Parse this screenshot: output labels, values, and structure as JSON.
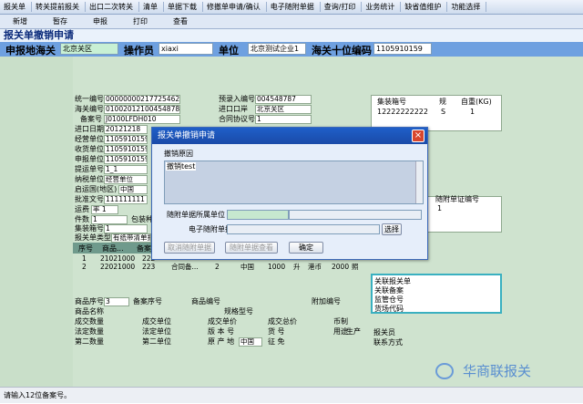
{
  "menu": [
    "报关单",
    "转关提前报关",
    "出口二次转关",
    "清单",
    "单据下载",
    "修撤单申请/确认",
    "电子随附单据",
    "查询/打印",
    "业务统计",
    "缺省值维护",
    "功能选择"
  ],
  "toolbar": [
    "新增",
    "暂存",
    "申报",
    "打印",
    "查看"
  ],
  "page_title": "报关单撤销申请",
  "header": {
    "customs_label": "申报地海关",
    "customs_value": "北京关区",
    "operator_label": "操作员",
    "operator_value": "xiaxi",
    "unit_label": "单位",
    "unit_value": "北京测试企业1",
    "code_label": "海关十位编码",
    "code_value": "1105910159"
  },
  "form": {
    "tongyi_label": "统一编号",
    "tongyi_value": "0000000021772546261",
    "yulu_label": "预录入编号",
    "yulu_value": "004548787",
    "haiguan_label": "海关编号",
    "haiguan_value": "010020121004548787",
    "jinchu_label": "进口口岸",
    "jinchu_value": "北京关区",
    "beian_label": "备案号",
    "beian_value": "J0100LFDH010",
    "hetong_label": "合同协议号",
    "hetong_value": "1",
    "jkrq_label": "进口日期",
    "jkrq_value": "20121218",
    "jydw_label": "经营单位",
    "jydw_value": "1105910159",
    "shdw_label": "收货单位",
    "shdw_value": "1105910159",
    "sbdw_label": "申报单位",
    "sbdw_value": "1105910159",
    "tydh_label": "提运单号",
    "tydh_value": "1_1",
    "nsdw_label": "纳税单位",
    "nsdw_value": "经营单位",
    "qydg_label": "启运国(地区)",
    "qydg_value": "中国",
    "pzwh_label": "批准文号",
    "pzwh_value": "111111111",
    "yunfei_label": "运费",
    "yunfei_value": "率 1",
    "jianshu_label": "件数",
    "jianshu_value": "1",
    "baozhuang_value": "包装种类",
    "jzx_label": "集装箱号",
    "jzx_value": "1",
    "bgdlx_label": "报关单类型",
    "bgdlx_value": "有纸带清单报关"
  },
  "container_grid": {
    "headers": [
      "集装箱号",
      "规",
      "自重(KG)"
    ],
    "rows": [
      [
        "12222222222",
        "S",
        "1"
      ]
    ]
  },
  "doc_grid": {
    "header": "随附单证编号",
    "rows": [
      "1"
    ]
  },
  "goods_grid": {
    "headers": [
      "序号",
      "商品...",
      "备案"
    ],
    "rows": [
      [
        "1",
        "21021000",
        "222",
        "",
        "",
        "",
        "",
        "",
        "",
        "",
        ""
      ],
      [
        "2",
        "22021000",
        "223",
        "合同备...",
        "2",
        "中国",
        "1000",
        "升",
        "港币",
        "2000",
        "照"
      ]
    ]
  },
  "bottom": {
    "spxh_label": "商品序号",
    "spxh_value": "3",
    "baxh_label": "备案序号",
    "spbh_label": "商品编号",
    "fjbh_label": "附加编号",
    "spmc_label": "商品名称",
    "ggxh_label": "规格型号",
    "cjsl_label": "成交数量",
    "cjdw_label": "成交单位",
    "cjdj_label": "成交单价",
    "cjzj_label": "成交总价",
    "bizhi_label": "币制",
    "fdsl_label": "法定数量",
    "fddw_label": "法定单位",
    "banben_label": "版 本 号",
    "huohao_label": "货 号",
    "yongtu_label": "用途",
    "sheng_label": "生产",
    "dier_label": "第二数量",
    "dierdw_label": "第二单位",
    "ycd_label": "原 产 地",
    "ycd_value": "中国",
    "zhengmian_label": "征 免"
  },
  "right_box": [
    "关联报关单",
    "关联备案",
    "监管仓号",
    "货场代码"
  ],
  "right_bottom": {
    "baoguanyuan": "报关员",
    "lianxi": "联系方式"
  },
  "dialog": {
    "title": "报关单撤销申请",
    "reason_label": "撤销原因",
    "reason_value": "撤销test",
    "owner_label": "随附单据所属单位",
    "edoc_label": "电子随附单据",
    "choose_btn": "选择",
    "cancel_attach_btn": "取消随附单据",
    "view_attach_btn": "随附单据查看",
    "ok_btn": "确定"
  },
  "status": "请输入12位备案号。",
  "watermark": "华商联报关"
}
